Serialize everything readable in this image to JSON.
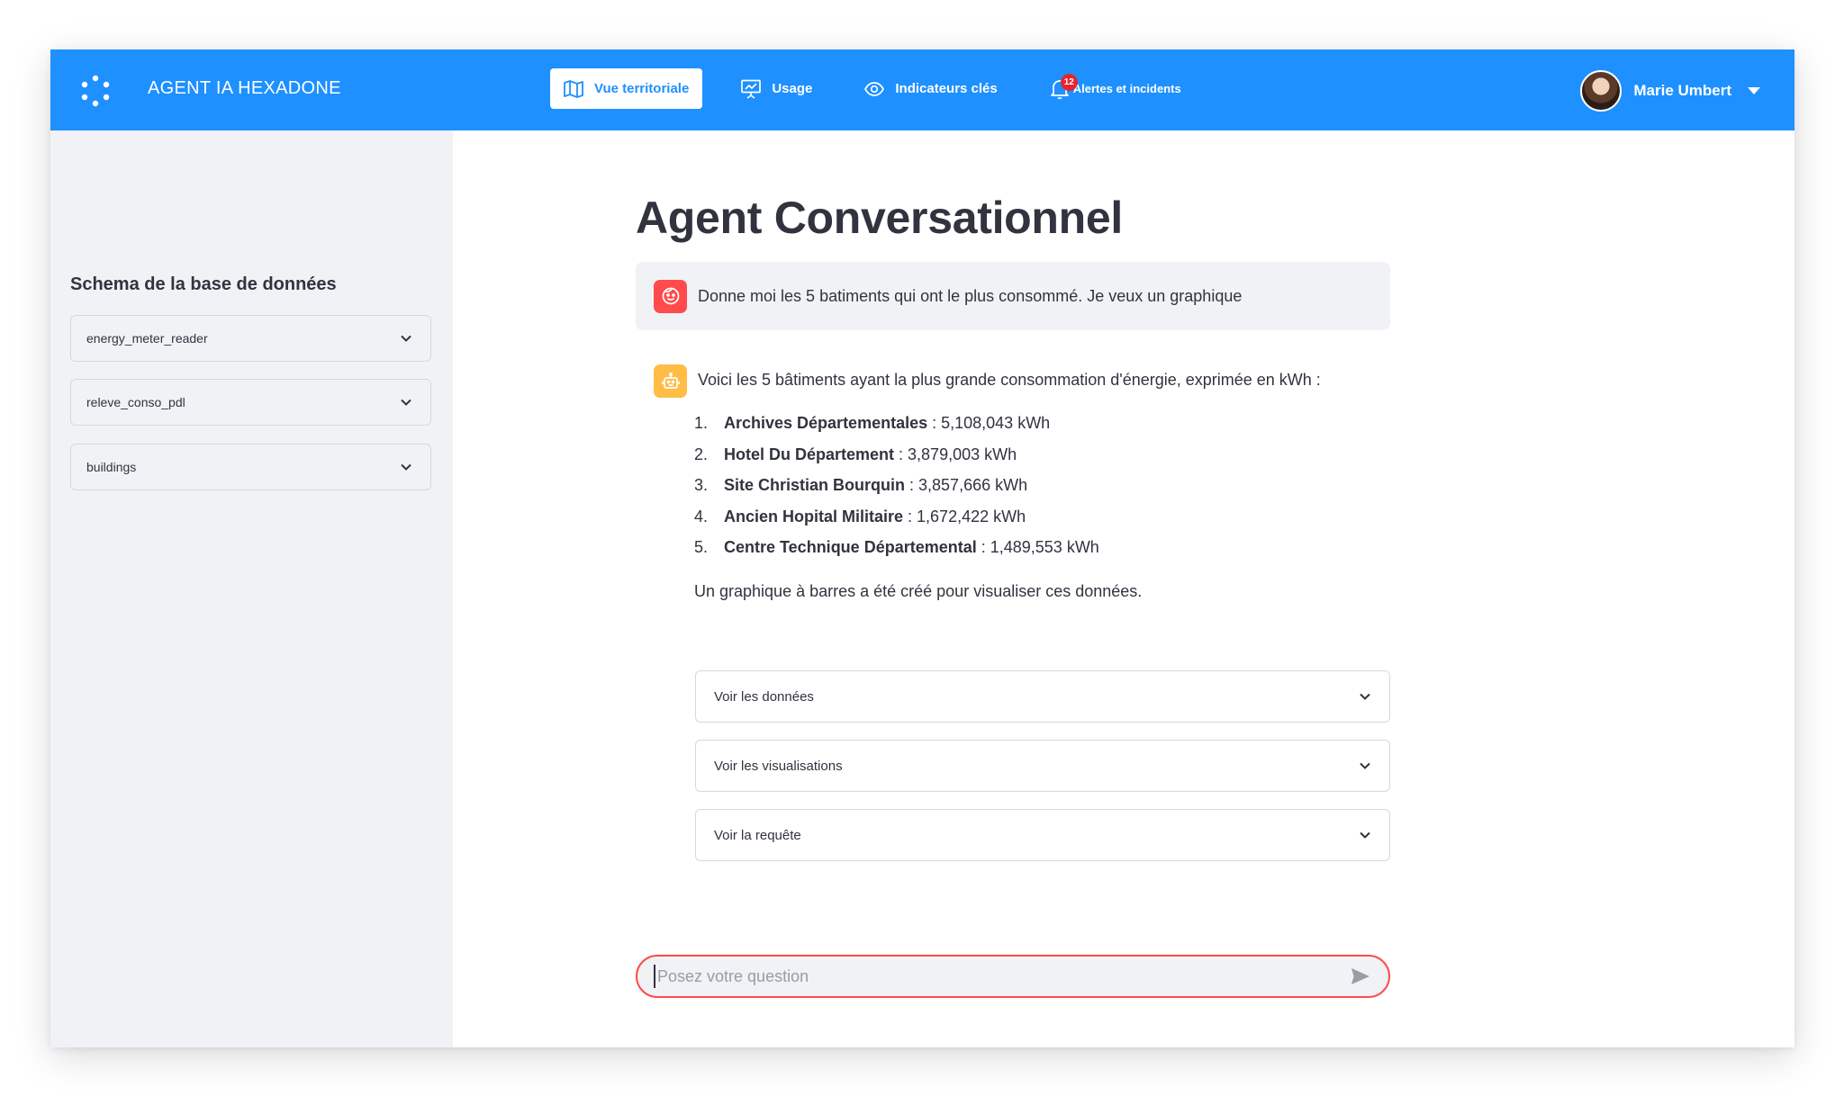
{
  "header": {
    "brand_title": "AGENT IA HEXADONE",
    "nav": [
      {
        "label": "Vue territoriale",
        "icon": "map-icon",
        "active": true
      },
      {
        "label": "Usage",
        "icon": "presentation-chart-icon",
        "active": false
      },
      {
        "label": "Indicateurs clés",
        "icon": "eye-icon",
        "active": false
      },
      {
        "label": "Alertes et incidents",
        "icon": "bell-icon",
        "active": false,
        "badge": "12"
      }
    ],
    "user_name": "Marie Umbert"
  },
  "sidebar": {
    "title": "Schema de la base de données",
    "expanders": [
      {
        "label": "energy_meter_reader"
      },
      {
        "label": "releve_conso_pdl"
      },
      {
        "label": "buildings"
      }
    ]
  },
  "main": {
    "title": "Agent Conversationnel",
    "user_message": "Donne moi les 5 batiments qui ont le plus consommé. Je veux un graphique",
    "assistant": {
      "intro": "Voici les 5 bâtiments ayant la plus grande consommation d'énergie, exprimée en kWh :",
      "results": [
        {
          "num": "1.",
          "name": "Archives Départementales",
          "value": " : 5,108,043 kWh"
        },
        {
          "num": "2.",
          "name": "Hotel Du Département",
          "value": " : 3,879,003 kWh"
        },
        {
          "num": "3.",
          "name": "Site Christian Bourquin",
          "value": " : 3,857,666 kWh"
        },
        {
          "num": "4.",
          "name": "Ancien Hopital Militaire",
          "value": " : 1,672,422 kWh"
        },
        {
          "num": "5.",
          "name": "Centre Technique Départemental",
          "value": " : 1,489,553 kWh"
        }
      ],
      "outro": "Un graphique à barres a été créé pour visualiser ces données.",
      "expanders": [
        {
          "label": "Voir les données"
        },
        {
          "label": "Voir les visualisations"
        },
        {
          "label": "Voir la requête"
        }
      ]
    },
    "chat_input": {
      "placeholder": "Posez votre question",
      "value": ""
    }
  },
  "colors": {
    "header_bg": "#1e90ff",
    "sidebar_bg": "#f0f2f6",
    "accent": "#ff4b4b",
    "bot_avatar": "#ffbd45",
    "badge": "#e5252d"
  }
}
